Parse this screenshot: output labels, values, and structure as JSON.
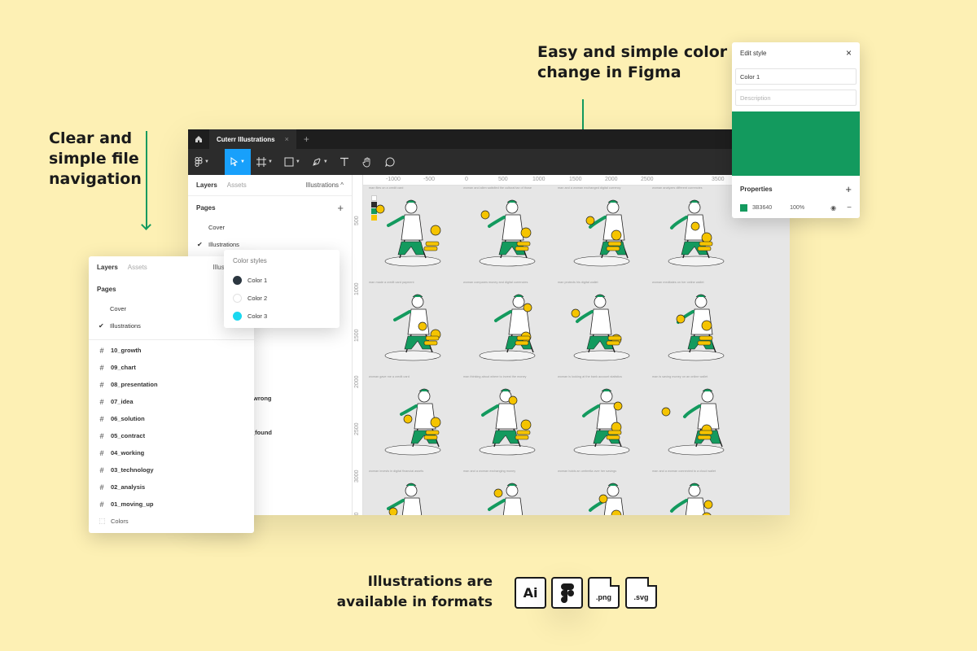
{
  "callouts": {
    "left": [
      "Clear and",
      "simple file",
      "navigation"
    ],
    "top": [
      "Easy and simple color",
      "change in Figma"
    ],
    "bottom": [
      "Illustrations are",
      "available in formats"
    ]
  },
  "figma": {
    "tab_title": "Cuterr Illustrations",
    "tab_close": "×",
    "tab_add": "+",
    "panel_tabs": {
      "layers": "Layers",
      "assets": "Assets",
      "page_selector": "Illustrations ^"
    },
    "pages_title": "Pages",
    "pages_add": "+",
    "pages": [
      {
        "name": "Cover",
        "selected": false
      },
      {
        "name": "Illustrations",
        "selected": true
      }
    ],
    "partial_layers": [
      "wrong",
      "_found"
    ],
    "ruler_x": [
      "-1000",
      "-500",
      "0",
      "500",
      "1000",
      "1500",
      "2000",
      "2500",
      "3500"
    ],
    "ruler_y": [
      "500",
      "1000",
      "1500",
      "2000",
      "2500",
      "3000",
      "3500"
    ],
    "palette": [
      "#ffffff",
      "#2b2b2b",
      "#139a5e",
      "#f5c400"
    ],
    "captions": [
      [
        "man flies on a credit card",
        "woman and alien satisfied the cultural tax of those",
        "man and a woman exchanged digital currency",
        "woman analyzes different currencies"
      ],
      [
        "man made a credit card payment",
        "woman compares money and digital currencies",
        "man protects his digital wallet",
        "woman meditates on her online wallet"
      ],
      [
        "woman gave me a credit card",
        "man thinking about where to invest the money",
        "woman is looking at the bank account statistics",
        "man is saving money on an online wallet"
      ],
      [
        "woman invests in digital financial assets",
        "man and a woman exchanging money",
        "woman holds an umbrella over her savings",
        "man and a woman connected to a cloud wallet"
      ]
    ]
  },
  "layers_card": {
    "tabs": {
      "layers": "Layers",
      "assets": "Assets",
      "page_selector": "Illustrations"
    },
    "pages_title": "Pages",
    "pages": [
      {
        "name": "Cover",
        "selected": false
      },
      {
        "name": "Illustrations",
        "selected": true
      }
    ],
    "frames": [
      "10_growth",
      "09_chart",
      "08_presentation",
      "07_idea",
      "06_solution",
      "05_contract",
      "04_working",
      "03_technology",
      "02_analysis",
      "01_moving_up"
    ],
    "colors_frame": "Colors"
  },
  "color_styles": {
    "title": "Color styles",
    "items": [
      {
        "name": "Color 1",
        "color": "#2b3640"
      },
      {
        "name": "Color 2",
        "color": "#ffffff"
      },
      {
        "name": "Color 3",
        "color": "#1ad8f0"
      }
    ]
  },
  "edit_style": {
    "title": "Edit style",
    "close": "×",
    "name_value": "Color 1",
    "description_placeholder": "Description",
    "swatch_color": "#139a5e",
    "properties_title": "Properties",
    "properties_add": "+",
    "hex": "3B3640",
    "opacity": "100%",
    "eye": "◉",
    "minus": "−"
  },
  "formats": {
    "ai": "Ai",
    "png": ".png",
    "svg": ".svg"
  },
  "colors": {
    "background": "#fdf0b4",
    "accent_green": "#139a5e",
    "accent_yellow": "#f5c400",
    "figma_blue": "#18a0fb"
  }
}
